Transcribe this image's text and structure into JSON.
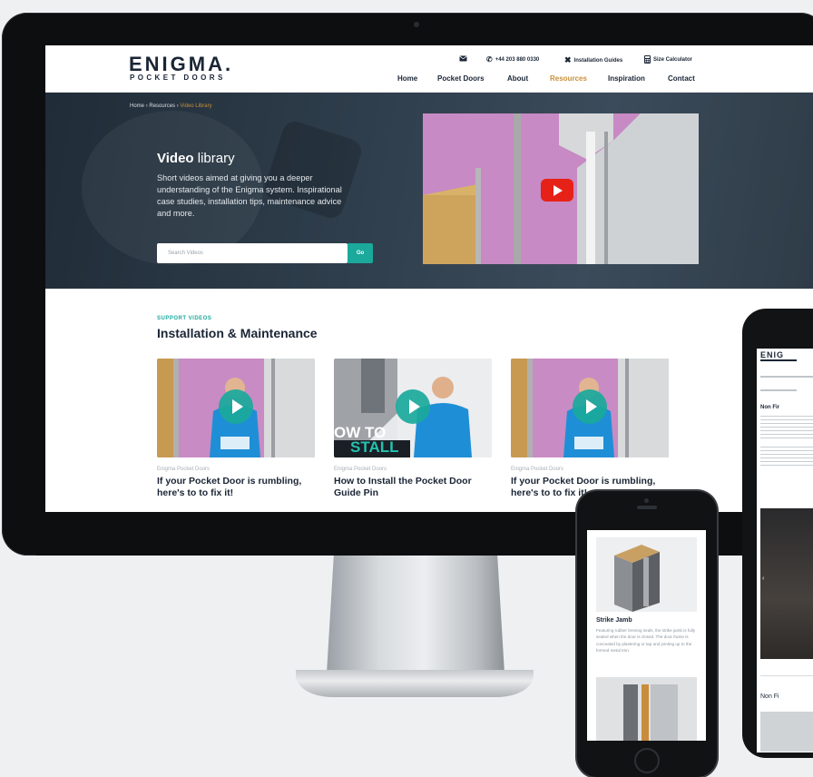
{
  "brand": {
    "name": "ENIGMA.",
    "tagline": "POCKET DOORS"
  },
  "topbar": {
    "phone": "+44 203 880 0330",
    "installation_guides": "Installation Guides",
    "size_calculator": "Size Calculator"
  },
  "nav": [
    "Home",
    "Pocket Doors",
    "About",
    "Resources",
    "Inspiration",
    "Contact"
  ],
  "breadcrumb": {
    "home": "Home",
    "resources": "Resources",
    "current": "Video Library"
  },
  "hero": {
    "title_bold": "Video",
    "title_rest": "library",
    "description": "Short videos aimed at giving you a deeper understanding of the Enigma system. Inspirational case studies, installation tips, maintenance advice and more.",
    "search_placeholder": "Search Videos",
    "search_button": "Go"
  },
  "support": {
    "kicker": "SUPPORT VIDEOS",
    "title": "Installation & Maintenance",
    "cards": [
      {
        "meta": "Enigma Pocket Doors",
        "title": "If your Pocket Door is rumbling, here's to to fix it!"
      },
      {
        "meta": "Enigma Pocket Doors",
        "title": "How to Install the Pocket Door Guide Pin",
        "overlay": "OW TO",
        "overlay2": "STALL"
      },
      {
        "meta": "Enigma Pocket Doors",
        "title": "If your Pocket Door is rumbling, here's to to fix it!"
      }
    ]
  },
  "phone": {
    "product_title": "Strike Jamb",
    "product_desc": "Featuring rubber brening seals, the strike jamb is fully sealed when the door is closed. The door frame is concealed by plastering or tap and jointing up to the formed metal trim."
  },
  "tablet": {
    "brand": "ENIG",
    "heading": "Non Fir",
    "section": "Non Fi"
  },
  "colors": {
    "accent_teal": "#1aa99b",
    "accent_gold": "#c8903a",
    "navy": "#1a2535",
    "youtube_red": "#e62117"
  }
}
